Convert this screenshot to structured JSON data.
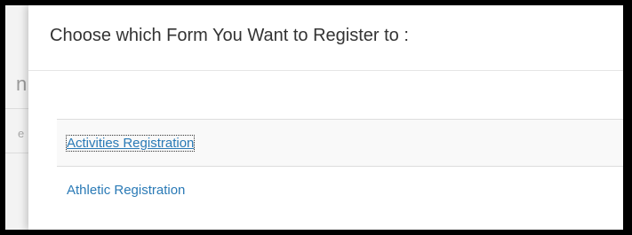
{
  "background_page": {
    "fragment_top": "n",
    "fragment_mid": "e"
  },
  "modal": {
    "title": "Choose which Form You Want to Register to :"
  },
  "forms": [
    {
      "label": "Activities Registration"
    },
    {
      "label": "Athletic Registration"
    }
  ],
  "colors": {
    "link": "#2a7ab6",
    "title": "#333333",
    "stripe": "#f9f9f9",
    "frame": "#000000"
  }
}
